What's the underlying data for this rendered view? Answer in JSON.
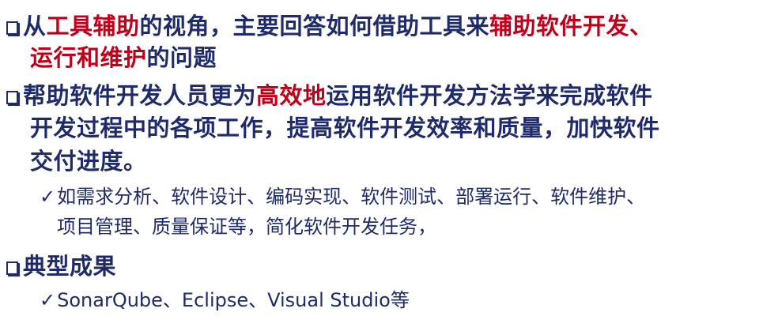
{
  "bullets": [
    {
      "segments": [
        "从",
        "工具辅助",
        "的视角，主要回答如何借助工具来",
        "辅助软件开发、"
      ],
      "cont": [
        "运行和维护",
        "的问题"
      ]
    },
    {
      "segments": [
        "帮助软件开发人员更为",
        "高效地",
        "运用软件开发方法学来完成软件"
      ],
      "cont1": "开发过程中的各项工作，提高软件开发效率和质量，加快软件",
      "cont2": "交付进度。",
      "sub": {
        "check": "✓",
        "line1": "如需求分析、软件设计、编码实现、软件测试、部署运行、软件维护、",
        "line2": "项目管理、质量保证等，简化软件开发任务，"
      }
    },
    {
      "title": "典型成果",
      "sub": {
        "check": "✓",
        "line1": "SonarQube、Eclipse、Visual Studio等"
      }
    }
  ],
  "colors": {
    "text": "#1f2b6b",
    "highlight": "#c0001a"
  },
  "icons": {
    "bullet": "hollow-square-icon",
    "sub": "check-icon"
  }
}
